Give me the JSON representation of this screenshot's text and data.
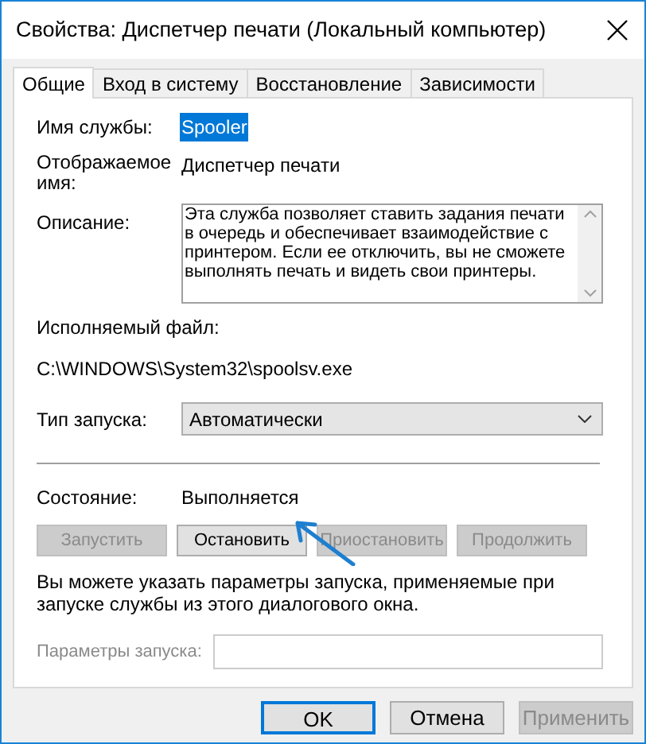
{
  "window": {
    "title": "Свойства: Диспетчер печати (Локальный компьютер)"
  },
  "tabs": [
    {
      "label": "Общие",
      "selected": true
    },
    {
      "label": "Вход в систему",
      "selected": false
    },
    {
      "label": "Восстановление",
      "selected": false
    },
    {
      "label": "Зависимости",
      "selected": false
    }
  ],
  "service_name": {
    "label": "Имя службы:",
    "value": "Spooler",
    "selected": true
  },
  "display_name": {
    "label": "Отображаемое имя:",
    "value": "Диспетчер печати"
  },
  "description": {
    "label": "Описание:",
    "value": "Эта служба позволяет ставить задания печати в очередь и обеспечивает взаимодействие с принтером. Если ее отключить, вы не сможете выполнять печать и видеть свои принтеры."
  },
  "executable": {
    "label": "Исполняемый файл:",
    "value": "C:\\WINDOWS\\System32\\spoolsv.exe"
  },
  "startup_type": {
    "label": "Тип запуска:",
    "value": "Автоматически"
  },
  "status": {
    "label": "Состояние:",
    "value": "Выполняется"
  },
  "service_buttons": [
    {
      "label": "Запустить",
      "disabled": true
    },
    {
      "label": "Остановить",
      "disabled": false
    },
    {
      "label": "Приостановить",
      "disabled": true
    },
    {
      "label": "Продолжить",
      "disabled": true
    }
  ],
  "hint": "Вы можете указать параметры запуска, применяемые при запуске службы из этого диалогового окна.",
  "start_parameters": {
    "label": "Параметры запуска:",
    "disabled": true
  },
  "dialog_buttons": [
    {
      "label": "OK",
      "disabled": false,
      "default": true
    },
    {
      "label": "Отмена",
      "disabled": false,
      "default": false
    },
    {
      "label": "Применить",
      "disabled": true,
      "default": false
    }
  ]
}
